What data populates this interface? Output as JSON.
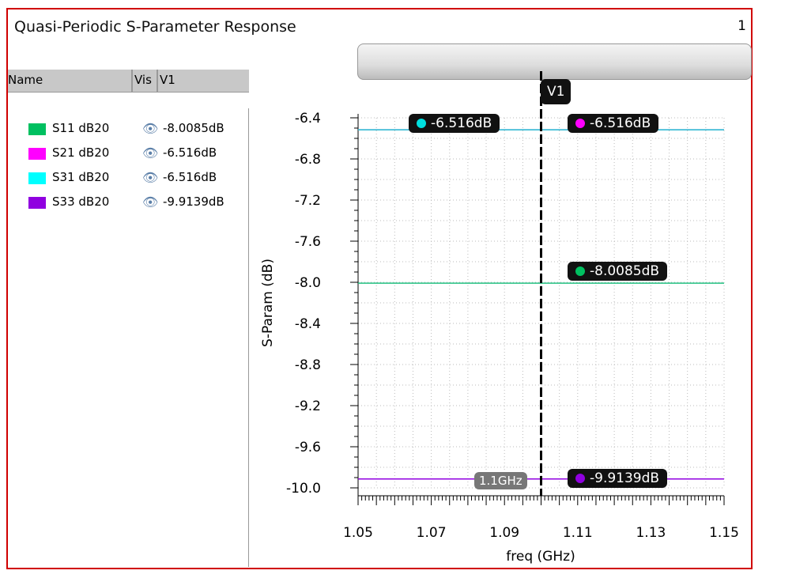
{
  "window": {
    "title": "Quasi-Periodic S-Parameter Response",
    "page_number": "1"
  },
  "legend": {
    "columns": [
      "Name",
      "Vis",
      "V1"
    ],
    "items": [
      {
        "name": "S11 dB20",
        "value": "-8.0085dB",
        "color": "#00c060"
      },
      {
        "name": "S21 dB20",
        "value": "-6.516dB",
        "color": "#ff00ff"
      },
      {
        "name": "S31 dB20",
        "value": "-6.516dB",
        "color": "#00ffff"
      },
      {
        "name": "S33 dB20",
        "value": "-9.9139dB",
        "color": "#9000e0"
      }
    ]
  },
  "cursor": {
    "label": "V1",
    "x_label": "1.1GHz"
  },
  "markers": [
    {
      "value": "-6.516dB",
      "color": "#00e0e0"
    },
    {
      "value": "-6.516dB",
      "color": "#ff00ff"
    },
    {
      "value": "-8.0085dB",
      "color": "#00c060"
    },
    {
      "value": "-9.9139dB",
      "color": "#9000e0"
    }
  ],
  "chart_data": {
    "type": "line",
    "xlabel": "freq (GHz)",
    "ylabel": "S-Param (dB)",
    "xlim": [
      1.05,
      1.15
    ],
    "ylim": [
      -10.0,
      -6.4
    ],
    "xticks": [
      "1.05",
      "1.07",
      "1.09",
      "1.11",
      "1.13",
      "1.15"
    ],
    "yticks": [
      "-6.4",
      "-6.8",
      "-7.2",
      "-7.6",
      "-8.0",
      "-8.4",
      "-8.8",
      "-9.2",
      "-9.6",
      "-10.0"
    ],
    "grid": true,
    "cursor_x": 1.1,
    "series": [
      {
        "name": "S11 dB20",
        "color": "#20c080",
        "x": [
          1.05,
          1.15
        ],
        "y": [
          -8.0085,
          -8.0085
        ]
      },
      {
        "name": "S21 dB20",
        "color": "#ff00ff",
        "x": [
          1.05,
          1.15
        ],
        "y": [
          -6.516,
          -6.516
        ]
      },
      {
        "name": "S31 dB20",
        "color": "#20d0d0",
        "x": [
          1.05,
          1.15
        ],
        "y": [
          -6.516,
          -6.516
        ]
      },
      {
        "name": "S33 dB20",
        "color": "#9000e0",
        "x": [
          1.05,
          1.15
        ],
        "y": [
          -9.9139,
          -9.9139
        ]
      }
    ]
  }
}
